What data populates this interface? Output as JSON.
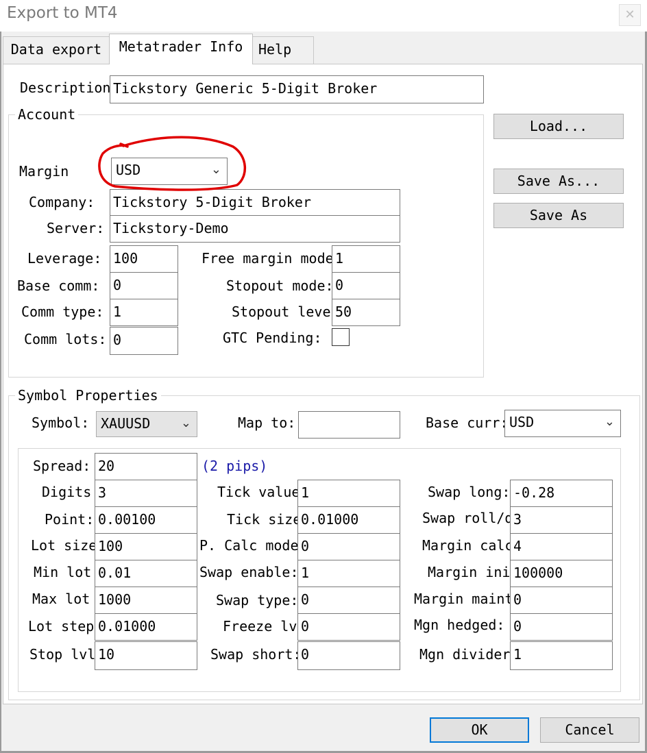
{
  "window": {
    "title": "Export to MT4",
    "close_glyph": "✕"
  },
  "tabs": [
    {
      "label": "Data export",
      "active": false
    },
    {
      "label": "Metatrader Info",
      "active": true
    },
    {
      "label": "Help",
      "active": false
    }
  ],
  "description": {
    "label": "Description",
    "value": "Tickstory Generic 5-Digit Broker"
  },
  "account": {
    "title": "Account",
    "margin": {
      "label": "Margin",
      "value": "USD",
      "icon": "chevron-down-icon"
    },
    "company": {
      "label": "Company:",
      "value": "Tickstory 5-Digit Broker"
    },
    "server": {
      "label": "Server:",
      "value": "Tickstory-Demo"
    },
    "leverage": {
      "label": "Leverage:",
      "value": "100"
    },
    "base_comm": {
      "label": "Base comm:",
      "value": "0"
    },
    "comm_type": {
      "label": "Comm type:",
      "value": "1"
    },
    "comm_lots": {
      "label": "Comm lots:",
      "value": "0"
    },
    "free_margin_mode": {
      "label": "Free margin mode",
      "value": "1"
    },
    "stopout_mode": {
      "label": "Stopout mode:",
      "value": "0"
    },
    "stopout_level": {
      "label": "Stopout leve",
      "value": "50"
    },
    "gtc_pending": {
      "label": "GTC Pending:",
      "checked": false
    }
  },
  "buttons": {
    "load": "Load...",
    "save_as_dots": "Save As...",
    "save_as": "Save As",
    "ok": "OK",
    "cancel": "Cancel"
  },
  "symbol_properties": {
    "title": "Symbol Properties",
    "symbol": {
      "label": "Symbol:",
      "value": "XAUUSD"
    },
    "map_to": {
      "label": "Map to:",
      "value": ""
    },
    "base_curr": {
      "label": "Base curr:",
      "value": "USD"
    },
    "spread": {
      "label": "Spread:",
      "value": "20",
      "note": "(2 pips)"
    },
    "col1": [
      {
        "label": "Digits",
        "value": "3"
      },
      {
        "label": "Point:",
        "value": "0.00100"
      },
      {
        "label": "Lot size",
        "value": "100"
      },
      {
        "label": "Min lot",
        "value": "0.01"
      },
      {
        "label": "Max lot",
        "value": "1000"
      },
      {
        "label": "Lot step",
        "value": "0.01000"
      },
      {
        "label": "Stop lvl",
        "value": "10"
      }
    ],
    "col2": [
      {
        "label": "Tick value",
        "value": "1"
      },
      {
        "label": "Tick size",
        "value": "0.01000"
      },
      {
        "label": "P. Calc mode",
        "value": "0"
      },
      {
        "label": "Swap enable:",
        "value": "1"
      },
      {
        "label": "Swap type:",
        "value": "0"
      },
      {
        "label": "Freeze lv",
        "value": "0"
      },
      {
        "label": "Swap short:",
        "value": "0"
      }
    ],
    "col3": [
      {
        "label": "Swap long:",
        "value": "-0.28"
      },
      {
        "label": "Swap roll/d",
        "value": "3"
      },
      {
        "label": "Margin calc",
        "value": "4"
      },
      {
        "label": "Margin ini",
        "value": "100000"
      },
      {
        "label": "Margin maint",
        "value": "0"
      },
      {
        "label": "Mgn hedged:",
        "value": "0"
      },
      {
        "label": "Mgn divider",
        "value": "1"
      }
    ]
  },
  "annotation": {
    "color": "#e00000"
  }
}
